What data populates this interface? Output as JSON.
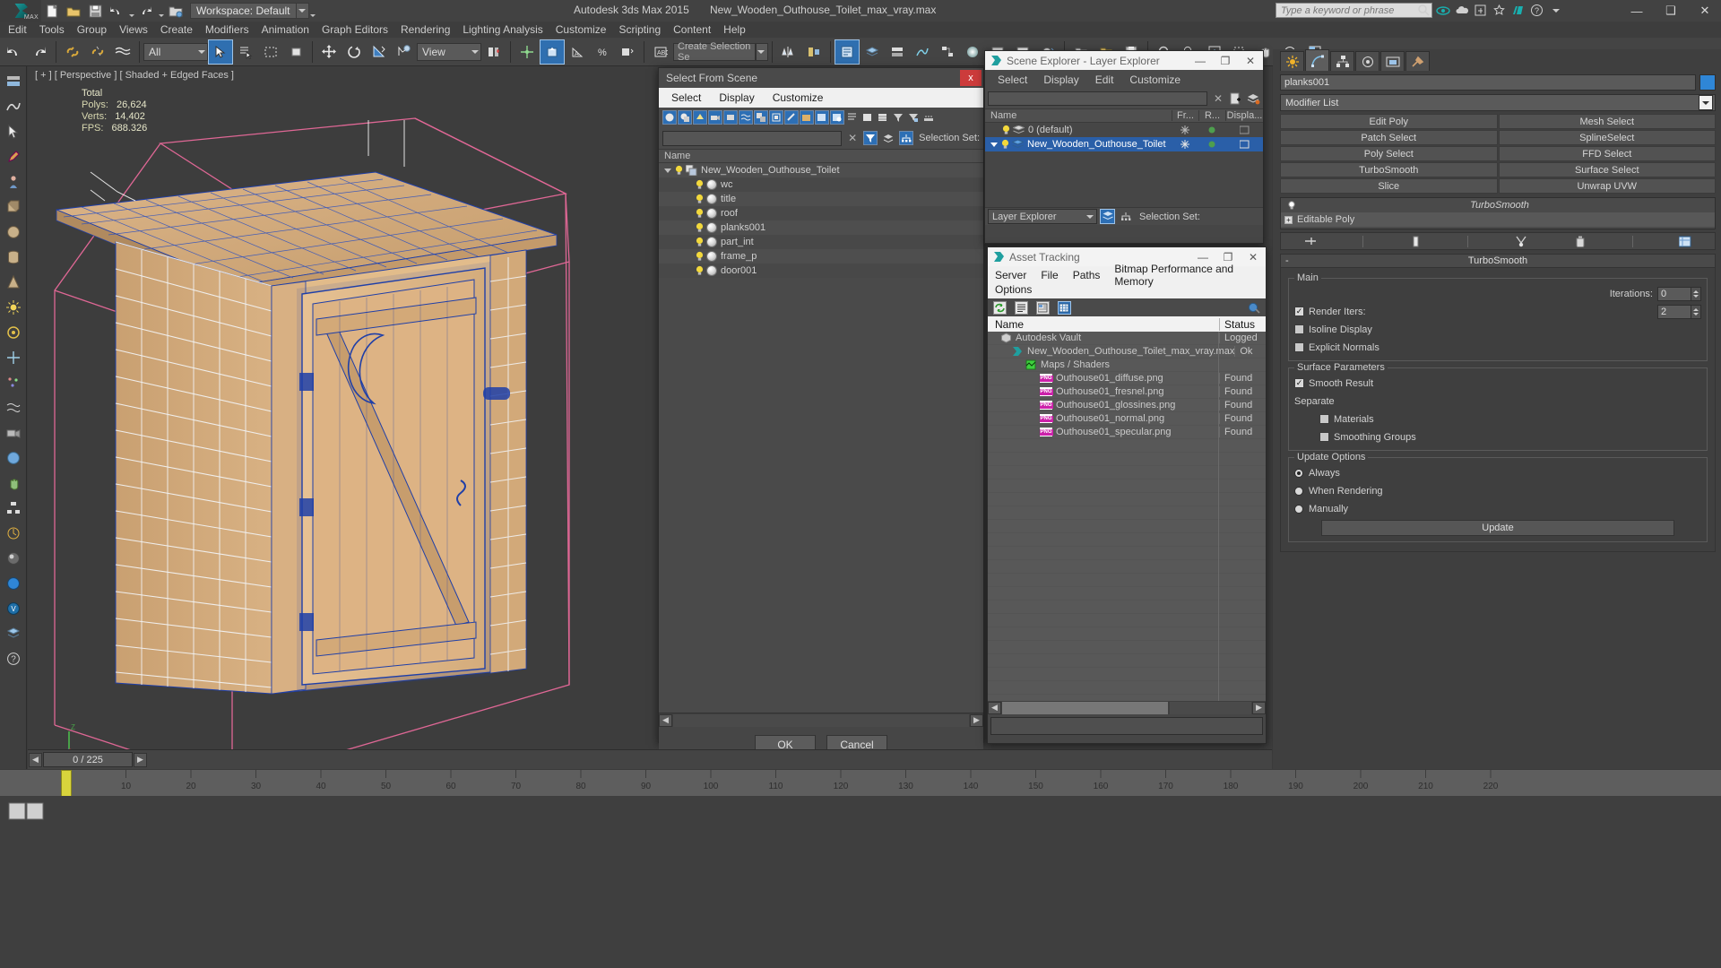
{
  "title_bar": {
    "app_title": "Autodesk 3ds Max  2015",
    "file_title": "New_Wooden_Outhouse_Toilet_max_vray.max",
    "workspace": "Workspace: Default",
    "search_placeholder": "Type a keyword or phrase",
    "minimize": "—",
    "maximize": "❑",
    "close": "✕"
  },
  "menubar": [
    "Edit",
    "Tools",
    "Group",
    "Views",
    "Create",
    "Modifiers",
    "Animation",
    "Graph Editors",
    "Rendering",
    "Lighting Analysis",
    "Customize",
    "Scripting",
    "Content",
    "Help"
  ],
  "toolbar": {
    "selection_filter": "All",
    "ref_coord_system": "View",
    "named_selection_set": "Create Selection Se"
  },
  "viewport": {
    "label": "[ + ] [ Perspective ] [ Shaded + Edged Faces ]",
    "stats": [
      {
        "key": "",
        "value": "Total"
      },
      {
        "key": "Polys:",
        "value": "26,624"
      },
      {
        "key": "Verts:",
        "value": "14,402"
      },
      {
        "key": "FPS:",
        "value": "688.326"
      }
    ]
  },
  "select_from_scene": {
    "title": "Select From Scene",
    "close_label": "x",
    "menu": [
      "Select",
      "Display",
      "Customize"
    ],
    "find_value": "",
    "column_header": "Name",
    "root": "New_Wooden_Outhouse_Toilet",
    "items": [
      "wc",
      "title",
      "roof",
      "planks001",
      "part_int",
      "frame_p",
      "door001"
    ],
    "ok_label": "OK",
    "cancel_label": "Cancel",
    "scroll_left": "◀",
    "scroll_right": "▶"
  },
  "scene_explorer": {
    "title": "Scene Explorer - Layer Explorer",
    "menu": [
      "Select",
      "Display",
      "Edit",
      "Customize"
    ],
    "find_value": "",
    "columns": [
      "Name",
      "Fr...",
      "R...",
      "Displa..."
    ],
    "rows": [
      {
        "name": "0 (default)",
        "selected": false,
        "expandable": false
      },
      {
        "name": "New_Wooden_Outhouse_Toilet",
        "selected": true,
        "expandable": true
      }
    ],
    "footer_combo": "Layer Explorer",
    "selection_set_label": "Selection Set:",
    "minimize": "—",
    "maximize": "❐",
    "close": "✕"
  },
  "asset_tracking": {
    "title": "Asset Tracking",
    "menu_row1": [
      "Server",
      "File",
      "Paths",
      "Bitmap Performance and Memory"
    ],
    "menu_row2": [
      "Options"
    ],
    "columns": [
      "Name",
      "Status"
    ],
    "rows": [
      {
        "name": "Autodesk Vault",
        "status": "Logged",
        "indent": 0,
        "icon": "vault-icon"
      },
      {
        "name": "New_Wooden_Outhouse_Toilet_max_vray.max",
        "status": "Ok",
        "indent": 1,
        "icon": "max-file-icon"
      },
      {
        "name": "Maps / Shaders",
        "status": "",
        "indent": 2,
        "icon": "maps-icon"
      },
      {
        "name": "Outhouse01_diffuse.png",
        "status": "Found",
        "indent": 3,
        "icon": "png-icon"
      },
      {
        "name": "Outhouse01_fresnel.png",
        "status": "Found",
        "indent": 3,
        "icon": "png-icon"
      },
      {
        "name": "Outhouse01_glossines.png",
        "status": "Found",
        "indent": 3,
        "icon": "png-icon"
      },
      {
        "name": "Outhouse01_normal.png",
        "status": "Found",
        "indent": 3,
        "icon": "png-icon"
      },
      {
        "name": "Outhouse01_specular.png",
        "status": "Found",
        "indent": 3,
        "icon": "png-icon"
      }
    ],
    "minimize": "—",
    "maximize": "❐",
    "close": "✕",
    "scroll_left": "◀",
    "scroll_right": "▶"
  },
  "command_panel": {
    "object_name": "planks001",
    "object_color": "#2f86d6",
    "modifier_list_label": "Modifier List",
    "modifier_buttons": [
      "Edit Poly",
      "Mesh Select",
      "Patch Select",
      "SplineSelect",
      "Poly Select",
      "FFD Select",
      "TurboSmooth",
      "Surface Select",
      "Slice",
      "Unwrap UVW"
    ],
    "stack": [
      {
        "label": "TurboSmooth",
        "italic": true
      },
      {
        "label": "Editable Poly",
        "italic": false
      }
    ],
    "rollout": {
      "title": "TurboSmooth",
      "minus": "-",
      "main_group": "Main",
      "iterations_label": "Iterations:",
      "iterations_value": "0",
      "render_iters_label": "Render Iters:",
      "render_iters_value": "2",
      "render_iters_checked": true,
      "isoline_label": "Isoline Display",
      "isoline_checked": false,
      "explicit_label": "Explicit Normals",
      "explicit_checked": false,
      "surface_group": "Surface Parameters",
      "smooth_result_label": "Smooth Result",
      "smooth_result_checked": true,
      "separate_label": "Separate",
      "materials_label": "Materials",
      "materials_checked": false,
      "smoothing_groups_label": "Smoothing Groups",
      "smoothing_groups_checked": false,
      "update_group": "Update Options",
      "update_always": "Always",
      "update_when_rendering": "When Rendering",
      "update_manually": "Manually",
      "update_selected": "Always",
      "update_button": "Update"
    }
  },
  "trackbar": {
    "frame_field": "0 / 225",
    "prev_label": "◀",
    "next_label": "▶"
  },
  "timeline": {
    "ticks": [
      "10",
      "20",
      "30",
      "40",
      "50",
      "60",
      "70",
      "80",
      "90",
      "100",
      "110",
      "120",
      "130",
      "140",
      "150",
      "160",
      "170",
      "180",
      "190",
      "200",
      "210",
      "220"
    ],
    "slider_frame": "0"
  }
}
